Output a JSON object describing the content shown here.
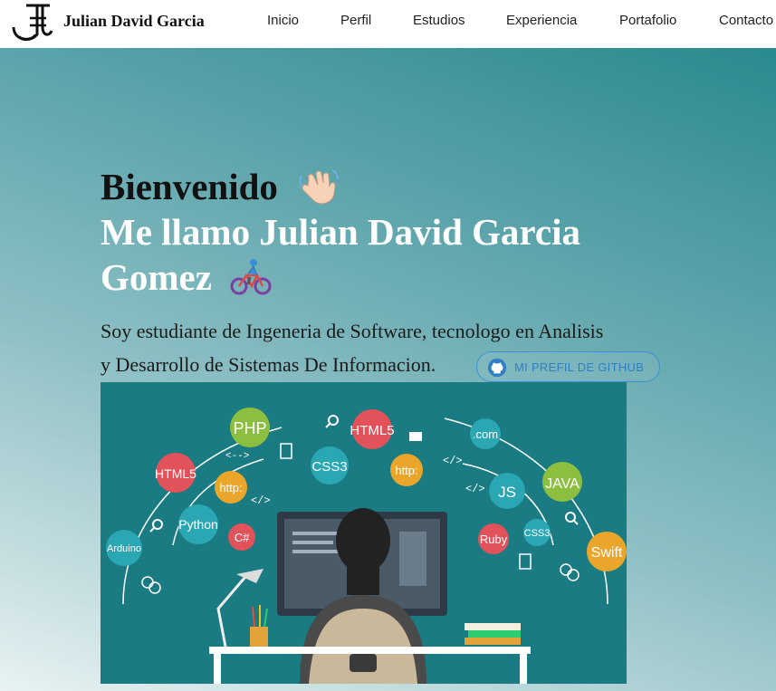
{
  "navbar": {
    "brand": "Julian David Garcia",
    "links": [
      "Inicio",
      "Perfil",
      "Estudios",
      "Experiencia",
      "Portafolio",
      "Contacto"
    ]
  },
  "hero": {
    "welcome": "Bienvenido",
    "name_line1": "Me llamo Julian David Garcia",
    "name_line2": "Gomez",
    "intro_line1": "Soy estudiante de Ingeneria de Software, tecnologo en Analisis",
    "intro_line2": "y Desarrollo de Sistemas De Informacion.",
    "github_button": "MI PREFIL DE GITHUB",
    "icons": [
      "waving-hand-icon",
      "cyclist-icon",
      "github-icon"
    ]
  },
  "illustration": {
    "bubbles": [
      "PHP",
      "HTML5",
      ".com",
      "HTML5",
      "CSS3",
      "http:",
      "JAVA",
      "http:",
      "JS",
      "Python",
      "C#",
      "Ruby",
      "CSS3",
      "Arduino",
      "Swift"
    ],
    "code_tags": [
      "<-->",
      "</>",
      "</>",
      "</>"
    ]
  },
  "colors": {
    "hero_dark": "#2a8a8f",
    "hero_light": "#e8f2f3",
    "illustration_bg": "#1a7b82",
    "button_blue": "#2f7fc7"
  }
}
